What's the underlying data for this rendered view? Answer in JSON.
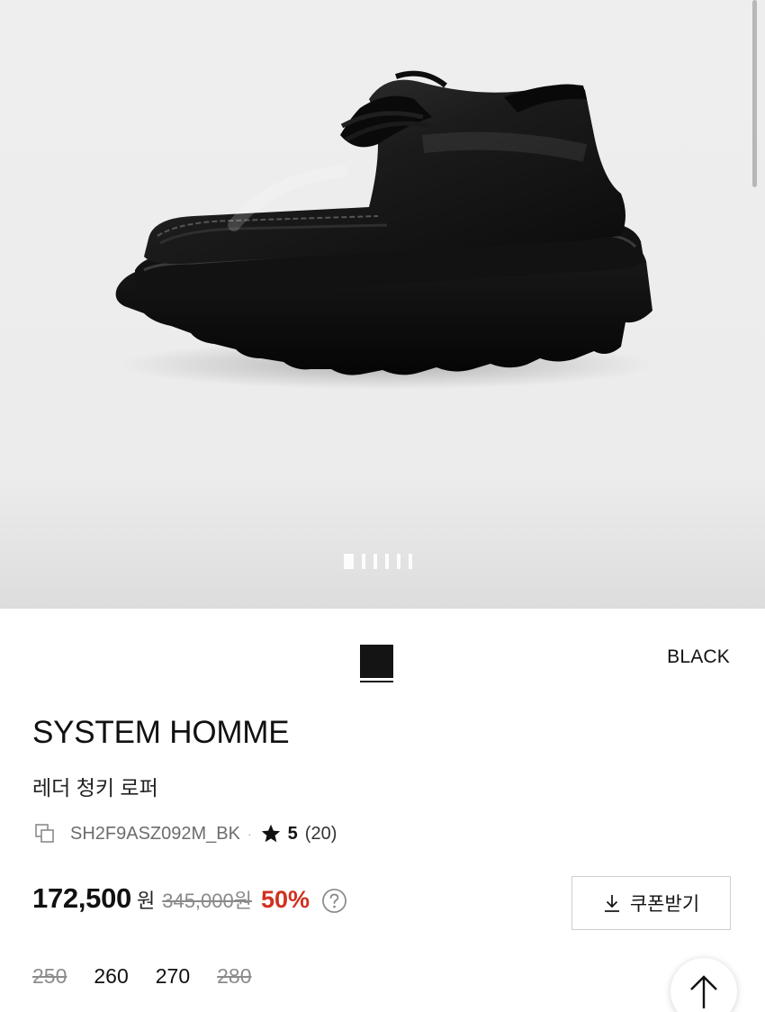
{
  "gallery": {
    "image_alt": "black leather chunky loafer",
    "page_count": 6,
    "active_index": 0
  },
  "color": {
    "selected": "BLACK",
    "swatch_color": "#141414"
  },
  "product": {
    "brand": "SYSTEM HOMME",
    "name": "레더 청키 로퍼",
    "sku": "SH2F9ASZ092M_BK",
    "separator": "·",
    "rating": "5",
    "review_count": "(20)"
  },
  "price": {
    "current": "172,500",
    "currency": "원",
    "original": "345,000원",
    "discount": "50%",
    "help_icon": "question-circle-icon"
  },
  "coupon": {
    "label": "쿠폰받기",
    "icon": "download-icon"
  },
  "sizes": [
    {
      "label": "250",
      "sold_out": true
    },
    {
      "label": "260",
      "sold_out": false
    },
    {
      "label": "270",
      "sold_out": false
    },
    {
      "label": "280",
      "sold_out": true
    }
  ],
  "scroll_top": {
    "icon": "arrow-up-icon"
  },
  "colors": {
    "discount_red": "#d0311f",
    "text": "#111111",
    "muted": "#6d6d6d"
  }
}
